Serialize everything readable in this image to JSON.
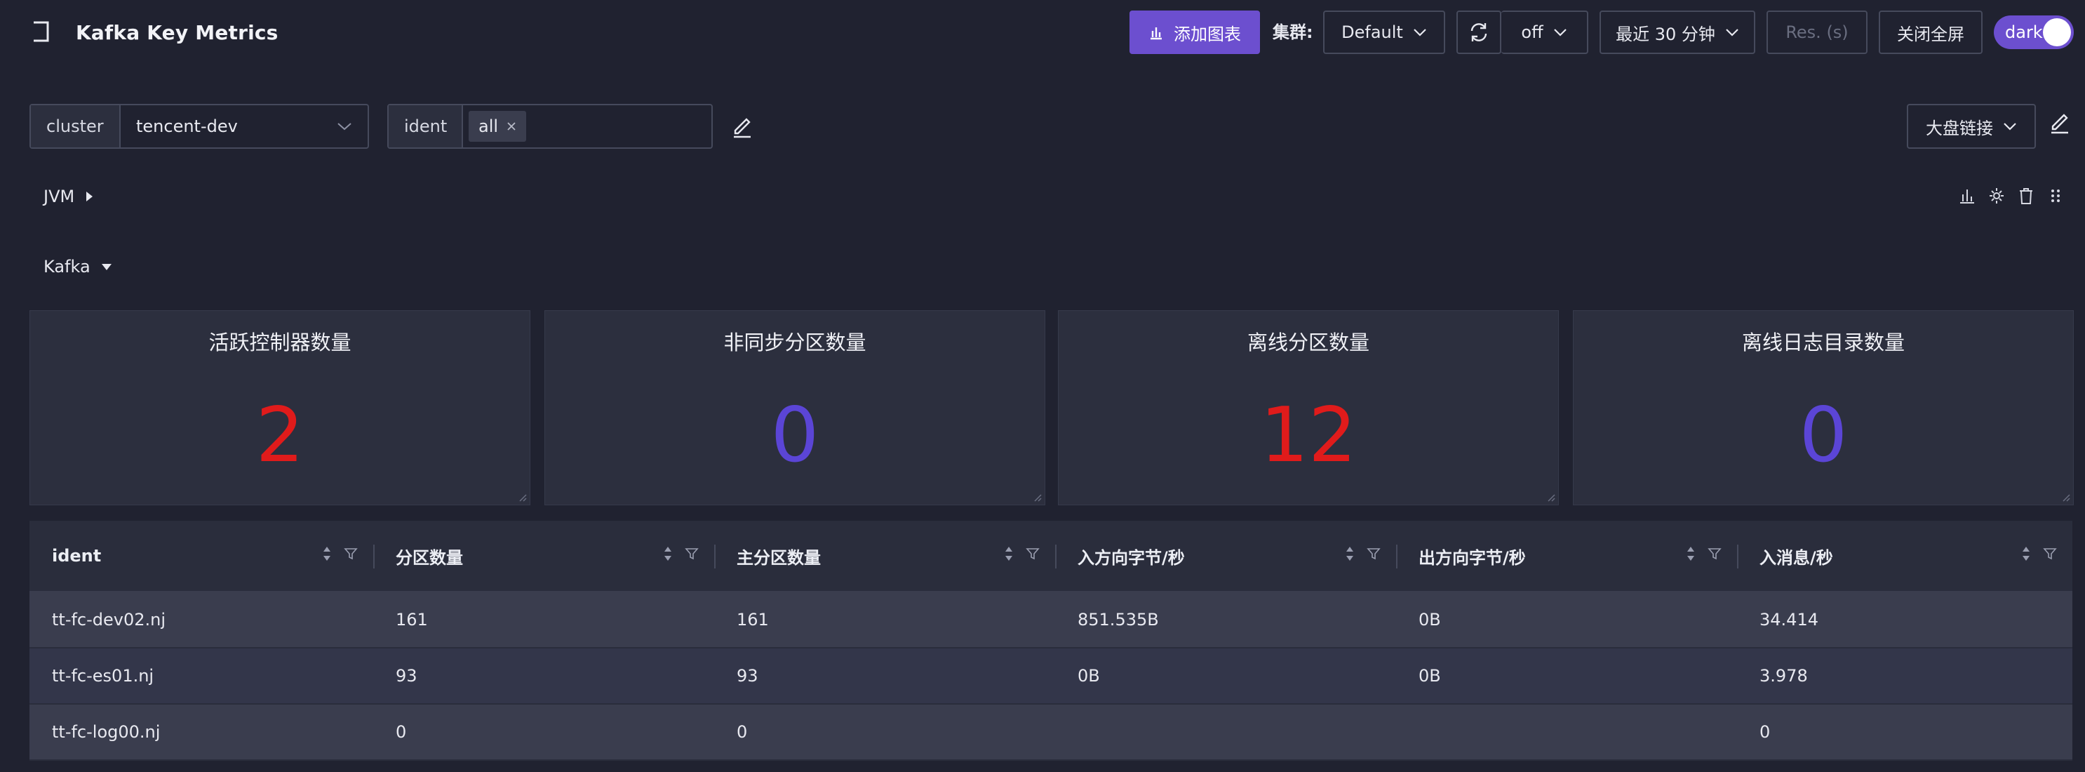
{
  "header": {
    "title": "Kafka Key Metrics",
    "add_chart_label": "添加图表",
    "cluster_label": "集群:",
    "cluster_value": "Default",
    "auto_refresh_value": "off",
    "time_range": "最近 30 分钟",
    "resolution_placeholder": "Res. (s)",
    "fullscreen_label": "关闭全屏",
    "theme_label": "dark"
  },
  "variables": {
    "cluster": {
      "label": "cluster",
      "value": "tencent-dev"
    },
    "ident": {
      "label": "ident",
      "tag": "all"
    },
    "dashboard_links_label": "大盘链接"
  },
  "groups": {
    "jvm": {
      "title": "JVM",
      "expanded": false
    },
    "kafka": {
      "title": "Kafka",
      "expanded": true
    }
  },
  "stats": [
    {
      "title": "活跃控制器数量",
      "value": "2",
      "color": "#e01b1b"
    },
    {
      "title": "非同步分区数量",
      "value": "0",
      "color": "#5b45d6"
    },
    {
      "title": "离线分区数量",
      "value": "12",
      "color": "#e01b1b"
    },
    {
      "title": "离线日志目录数量",
      "value": "0",
      "color": "#5b45d6"
    }
  ],
  "table": {
    "columns": [
      "ident",
      "分区数量",
      "主分区数量",
      "入方向字节/秒",
      "出方向字节/秒",
      "入消息/秒"
    ],
    "rows": [
      [
        "tt-fc-dev02.nj",
        "161",
        "161",
        "851.535B",
        "0B",
        "34.414"
      ],
      [
        "tt-fc-es01.nj",
        "93",
        "93",
        "0B",
        "0B",
        "3.978"
      ],
      [
        "tt-fc-log00.nj",
        "0",
        "0",
        "",
        "",
        "0"
      ]
    ]
  },
  "colors": {
    "accent": "#6c4fcf",
    "danger": "#e01b1b",
    "ok": "#5b45d6"
  }
}
